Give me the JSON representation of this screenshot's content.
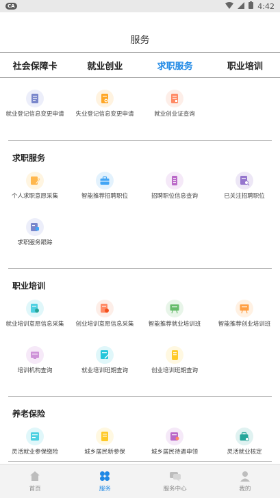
{
  "status": {
    "badge": "CA",
    "time": "4:42"
  },
  "header": {
    "title": "服务"
  },
  "tabs": [
    {
      "label": "社会保障卡"
    },
    {
      "label": "就业创业"
    },
    {
      "label": "求职服务"
    },
    {
      "label": "职业培训"
    }
  ],
  "active_tab": "求职服务",
  "sections": {
    "top": {
      "items": [
        {
          "label": "就业登记信息变更申请",
          "icon": "document-edit-icon",
          "color": "#7986cb"
        },
        {
          "label": "失业登记信息变更申请",
          "icon": "document-orange-icon",
          "color": "#ffa726"
        },
        {
          "label": "就业创业证查询",
          "icon": "certificate-icon",
          "color": "#ff8a65"
        }
      ]
    },
    "job": {
      "title": "求职服务",
      "items": [
        {
          "label": "个人求职意愿采集",
          "icon": "pencil-doc-icon",
          "color": "#ffb74d"
        },
        {
          "label": "智能推荐招聘职位",
          "icon": "briefcase-icon",
          "color": "#42a5f5"
        },
        {
          "label": "招聘职位信息查询",
          "icon": "document-search-icon",
          "color": "#ba68c8"
        },
        {
          "label": "已关注招聘职位",
          "icon": "bookmark-search-icon",
          "color": "#9575cd"
        },
        {
          "label": "求职服务跟踪",
          "icon": "tracking-icon",
          "color": "#7986cb"
        }
      ]
    },
    "training": {
      "title": "职业培训",
      "items": [
        {
          "label": "就业培训意愿信息采集",
          "icon": "training-collect-icon",
          "color": "#4dd0e1"
        },
        {
          "label": "创业培训意愿信息采集",
          "icon": "entrepreneur-collect-icon",
          "color": "#ff8a65"
        },
        {
          "label": "智能推荐就业培训班",
          "icon": "board-green-icon",
          "color": "#66bb6a"
        },
        {
          "label": "智能推荐创业培训班",
          "icon": "board-orange-icon",
          "color": "#ff9f43"
        },
        {
          "label": "培训机构查询",
          "icon": "institution-icon",
          "color": "#ce93d8"
        },
        {
          "label": "就业培训班期查询",
          "icon": "class-teal-icon",
          "color": "#26c6da"
        },
        {
          "label": "创业培训班期查询",
          "icon": "class-yellow-icon",
          "color": "#ffca28"
        }
      ]
    },
    "pension": {
      "title": "养老保险",
      "items": [
        {
          "label": "灵活就业参保缴险",
          "icon": "insurance-card-icon",
          "color": "#4dd0e1"
        },
        {
          "label": "城乡居民新参保",
          "icon": "resident-new-icon",
          "color": "#ffca28"
        },
        {
          "label": "城乡居民待遇申领",
          "icon": "benefit-claim-icon",
          "color": "#ba68c8"
        },
        {
          "label": "灵活就业核定",
          "icon": "verify-icon",
          "color": "#26a69a"
        }
      ]
    }
  },
  "bottom_nav": [
    {
      "label": "首页",
      "icon": "home-icon"
    },
    {
      "label": "服务",
      "icon": "services-icon"
    },
    {
      "label": "服务中心",
      "icon": "chat-icon"
    },
    {
      "label": "我的",
      "icon": "person-icon"
    }
  ],
  "active_nav": "服务"
}
